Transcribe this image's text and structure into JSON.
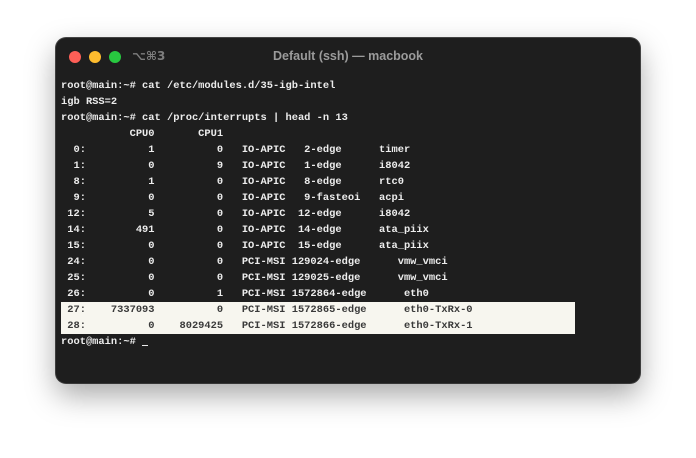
{
  "window": {
    "title": "Default (ssh) — macbook",
    "shortcut": "⌥⌘3",
    "controls": [
      "close",
      "minimize",
      "zoom"
    ]
  },
  "terminal": {
    "lines": [
      "root@main:~# cat /etc/modules.d/35-igb-intel",
      "igb RSS=2",
      "root@main:~# cat /proc/interrupts | head -n 13",
      "           CPU0       CPU1",
      "  0:          1          0   IO-APIC   2-edge      timer",
      "  1:          0          9   IO-APIC   1-edge      i8042",
      "  8:          1          0   IO-APIC   8-edge      rtc0",
      "  9:          0          0   IO-APIC   9-fasteoi   acpi",
      " 12:          5          0   IO-APIC  12-edge      i8042",
      " 14:        491          0   IO-APIC  14-edge      ata_piix",
      " 15:          0          0   IO-APIC  15-edge      ata_piix",
      " 24:          0          0   PCI-MSI 129024-edge      vmw_vmci",
      " 25:          0          0   PCI-MSI 129025-edge      vmw_vmci",
      " 26:          0          1   PCI-MSI 1572864-edge      eth0",
      " 27:    7337093          0   PCI-MSI 1572865-edge      eth0-TxRx-0",
      " 28:          0    8029425   PCI-MSI 1572866-edge      eth0-TxRx-1"
    ],
    "highlighted": [
      14,
      15
    ],
    "prompt": "root@main:~# "
  }
}
